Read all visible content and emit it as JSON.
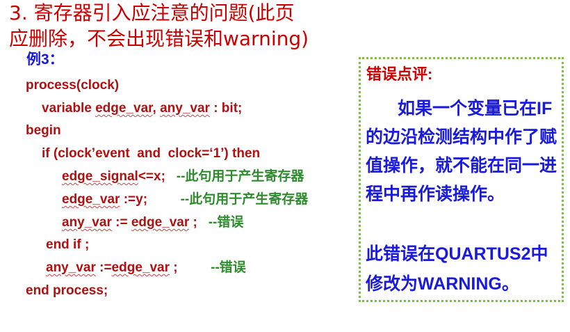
{
  "title": {
    "line1": "3. 寄存器引入应注意的问题(此页",
    "line2": "应删除，不会出现错误和warning)"
  },
  "example_label": "例3：",
  "code": {
    "l1": "process(clock)",
    "l2_a": "variable ",
    "l2_b": "edge_var",
    "l2_c": ", ",
    "l2_d": "any_var",
    "l2_e": " : bit;",
    "l3": "begin",
    "l4": "if (clock’event  and  clock=‘1’) then",
    "l5_a": "edge_signal",
    "l5_b": "<=x;   ",
    "l5_c": "--此句用于产生寄存器",
    "l6_a": "edge_var",
    "l6_b": " :=y;         ",
    "l6_c": "--此句用于产生寄存器",
    "l7_a": "any_var",
    "l7_b": " := ",
    "l7_c": "edge_var",
    "l7_d": " ;   ",
    "l7_e": "--错误",
    "l8": "end if ;",
    "l9_a": "any_var",
    "l9_b": " :=",
    "l9_c": "edge_var",
    "l9_d": " ;         ",
    "l9_e": "--错误",
    "l10": "end process;"
  },
  "note": {
    "title": "错误点评:",
    "body": "如果一个变量已在IF的边沿检测结构中作了赋值操作，就不能在同一进程中再作读操作。",
    "body2": "此错误在QUARTUS2中修改为WARNING。"
  }
}
